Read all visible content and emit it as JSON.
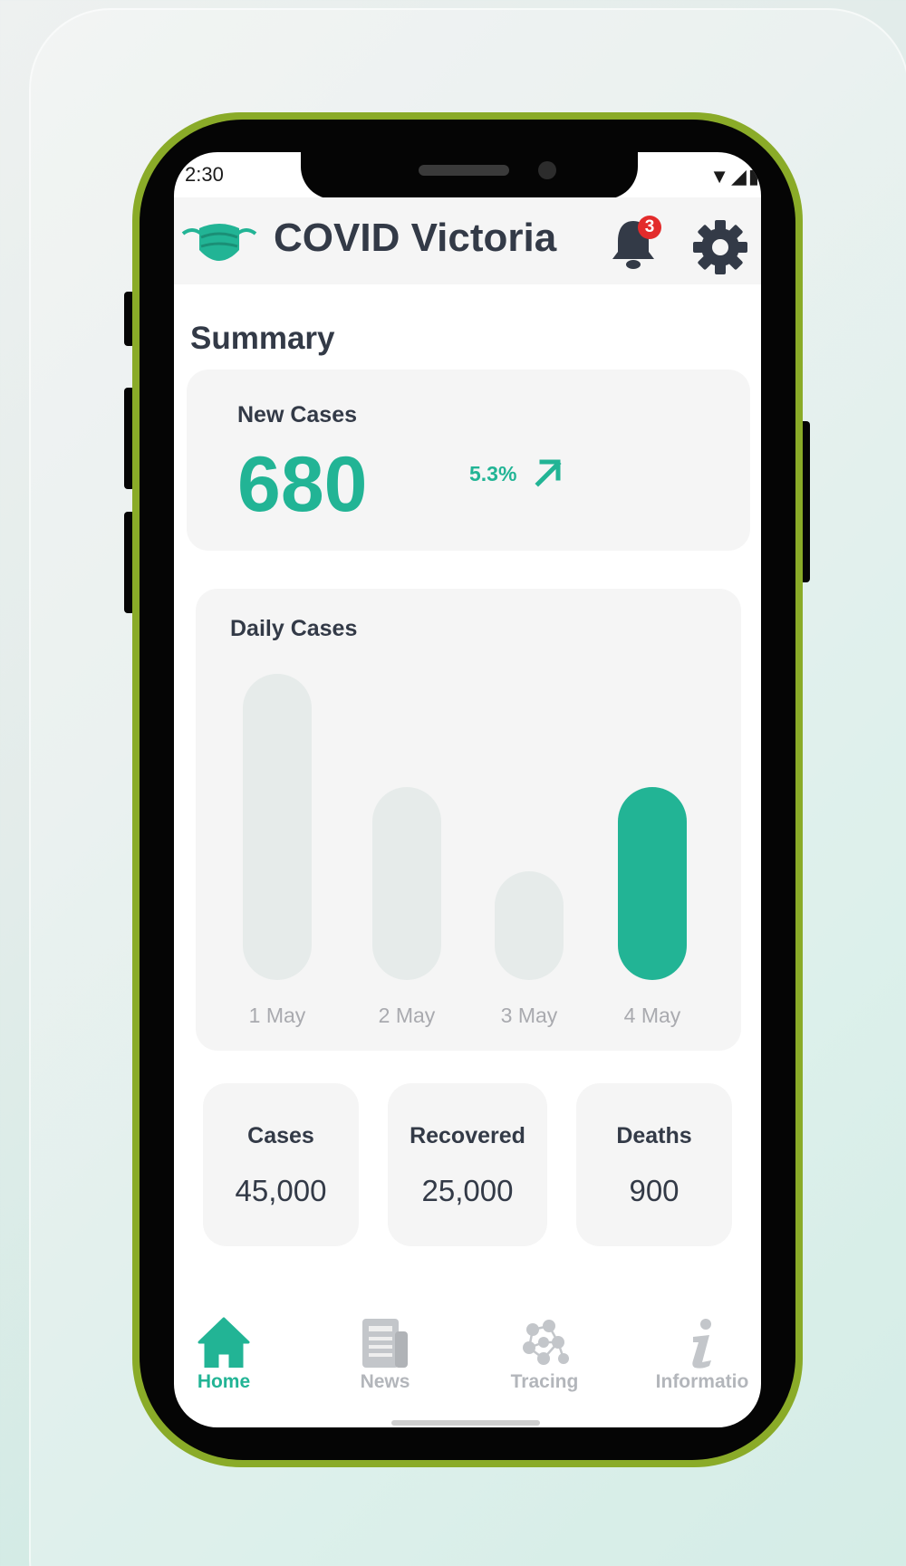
{
  "status_bar": {
    "time": "2:30",
    "icons": "▼◢▮"
  },
  "header": {
    "title": "COVID Victoria",
    "notification_count": "3"
  },
  "summary": {
    "section_title": "Summary",
    "new_cases": {
      "label": "New Cases",
      "value": "680",
      "change": "5.3%",
      "trend": "up"
    }
  },
  "daily_cases": {
    "label": "Daily Cases",
    "highlight_color": "#22b495",
    "chart_data": {
      "type": "bar",
      "title": "Daily Cases",
      "categories": [
        "1 May",
        "2 May",
        "3 May",
        "4 May"
      ],
      "values": [
        310,
        195,
        110,
        195
      ],
      "highlight_index": 3
    }
  },
  "stats": [
    {
      "label": "Cases",
      "value": "45,000"
    },
    {
      "label": "Recovered",
      "value": "25,000"
    },
    {
      "label": "Deaths",
      "value": "900"
    }
  ],
  "bottom_nav": [
    {
      "label": "Home",
      "icon": "home-icon",
      "active": true
    },
    {
      "label": "News",
      "icon": "newspaper-icon",
      "active": false
    },
    {
      "label": "Tracing",
      "icon": "tracing-network-icon",
      "active": false
    },
    {
      "label": "Informatio",
      "icon": "info-icon",
      "active": false
    }
  ],
  "colors": {
    "accent": "#22b495",
    "text": "#333a47",
    "phone_frame": "#8aab28"
  }
}
